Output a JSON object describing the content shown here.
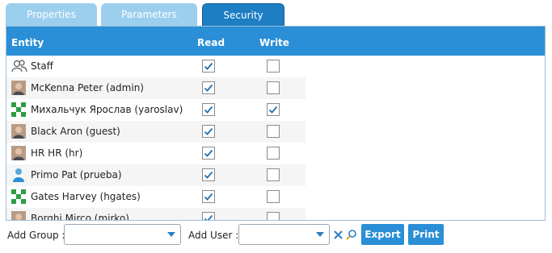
{
  "tabs": [
    {
      "label": "Properties",
      "active": false
    },
    {
      "label": "Parameters",
      "active": false
    },
    {
      "label": "Security",
      "active": true
    }
  ],
  "grid": {
    "headers": {
      "entity": "Entity",
      "read": "Read",
      "write": "Write"
    },
    "rows": [
      {
        "name": "Staff",
        "avatar": "group-icon",
        "read": true,
        "write": false
      },
      {
        "name": "McKenna Peter (admin)",
        "avatar": "user-photo",
        "read": true,
        "write": false
      },
      {
        "name": "Михальчук Ярослав (yaroslav)",
        "avatar": "identicon",
        "read": true,
        "write": true
      },
      {
        "name": "Black Aron (guest)",
        "avatar": "user-photo",
        "read": true,
        "write": false
      },
      {
        "name": "HR HR (hr)",
        "avatar": "user-photo",
        "read": true,
        "write": false
      },
      {
        "name": "Primo Pat (prueba)",
        "avatar": "user-icon",
        "read": true,
        "write": false
      },
      {
        "name": "Gates Harvey (hgates)",
        "avatar": "identicon",
        "read": true,
        "write": false
      },
      {
        "name": "Borghi Mirco (mirko)",
        "avatar": "user-photo",
        "read": true,
        "write": false
      }
    ]
  },
  "footer": {
    "add_group_label": "Add Group :",
    "add_group_value": "",
    "add_user_label": "Add User :",
    "add_user_value": "",
    "export_label": "Export",
    "print_label": "Print"
  },
  "colors": {
    "accent": "#2a8fd6",
    "tab_inactive": "#9ccfee",
    "tab_active": "#1d7ec4"
  }
}
